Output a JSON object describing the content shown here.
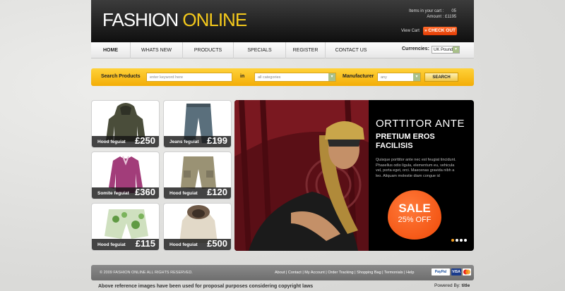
{
  "header": {
    "logo_part1": "FASHION",
    "logo_part2": "ONLINE",
    "cart_items_label": "Items in your cart :",
    "cart_items_value": "05",
    "cart_amount_label": "Amount :",
    "cart_amount_value": "£1195",
    "view_cart": "View Cart",
    "checkout": "CHECK OUT",
    "checkout_arrow": "»"
  },
  "nav": {
    "items": [
      "HOME",
      "WHATS NEW",
      "PRODUCTS",
      "SPECIALS",
      "REGISTER",
      "CONTACT US"
    ],
    "currencies_label": "Currencies:",
    "currency_value": "UK Pound"
  },
  "search": {
    "label": "Search Products",
    "keyword_placeholder": "enter keyword here",
    "in_label": "in",
    "category_value": "all categories",
    "manufacturer_label": "Manufacturer",
    "manufacturer_value": "any",
    "button": "SEARCH"
  },
  "products": [
    {
      "name": "Hood feguiat",
      "price": "£250",
      "icon": "hooded-jacket"
    },
    {
      "name": "Jeans feguiat",
      "price": "£199",
      "icon": "jeans"
    },
    {
      "name": "Somite feguiat",
      "price": "£360",
      "icon": "blouse"
    },
    {
      "name": "Hood feguiat",
      "price": "£120",
      "icon": "cargo-shorts"
    },
    {
      "name": "Hood feguiat",
      "price": "£115",
      "icon": "shorts"
    },
    {
      "name": "Hood feguiat",
      "price": "£500",
      "icon": "fur-hood-jacket"
    }
  ],
  "banner": {
    "title": "ORTTITOR ANTE",
    "subtitle": "PRETIUM EROS FACILISIS",
    "text": "Quisque porttitor ante nec est feugiat tincidunt. Phasellus odio ligula, elementum eu, vehicula vel, porta eget, orci. Maecenas gravida nibh a leo. Aliquam molestie diam congue id",
    "sale": "SALE",
    "sale_off": "25% OFF"
  },
  "footer": {
    "copyright": "© 2009 FASHION ONLINE ALL RIGHTS RESERVED.",
    "links": "About | Contact | My Account | Order Tracking | Shopping Bag | Termonials | Help",
    "pay1": "PayPal",
    "pay2": "VISA"
  },
  "note": "Above reference images have been  used for proposal purposes considering copyright laws",
  "powered_label": "Powered By:",
  "powered_brand": "title",
  "colors": {
    "accent": "#f4c91c",
    "checkout": "#e8450c",
    "sale": "#f25a12"
  }
}
